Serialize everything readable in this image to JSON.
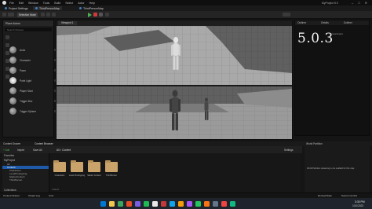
{
  "titlebar": {
    "menus": [
      "File",
      "Edit",
      "Window",
      "Tools",
      "Build",
      "Select",
      "Actor",
      "Help"
    ],
    "project_name": "MyProject 5.0",
    "controls": [
      "–",
      "□",
      "✕"
    ]
  },
  "tabs": [
    {
      "label": "Project Settings"
    },
    {
      "label": "ThirdPersonMap"
    },
    {
      "label": "ThirdPersonMap"
    }
  ],
  "toolbar": {
    "mode_label": "Selection Mode",
    "icons": [
      "save-icon",
      "content-icon",
      "blueprint-icon",
      "cinematic-icon",
      "play-icon",
      "stop-icon",
      "pause-icon"
    ]
  },
  "left_panel": {
    "title": "Place Actors",
    "search_placeholder": "Search Classes",
    "actors": [
      {
        "label": "Actor"
      },
      {
        "label": "Character"
      },
      {
        "label": "Pawn"
      },
      {
        "label": "Point Light"
      },
      {
        "label": "Player Start"
      },
      {
        "label": "Trigger Box"
      },
      {
        "label": "Trigger Sphere"
      }
    ]
  },
  "viewport": {
    "tab_label": "Viewport 1"
  },
  "outliner": {
    "tabs": [
      "Outliner",
      "Details",
      "Outliner"
    ],
    "big_version": "5.0.3",
    "version_sub": "Unreal Engine"
  },
  "content_browser": {
    "tabs": [
      "Content Drawer",
      "Content Browser"
    ],
    "toolbar": {
      "add_label": "+ Add",
      "import_label": "Import",
      "save_label": "Save All",
      "path": "All > Content",
      "settings_label": "Settings"
    },
    "sections": {
      "favorites": "Favorites",
      "project": "MyProject",
      "collections": "Collections"
    },
    "tree": [
      {
        "label": "All",
        "selected": false
      },
      {
        "label": "Content",
        "selected": true
      },
      {
        "label": "Characters",
        "selected": false
      },
      {
        "label": "LevelPrototyping",
        "selected": false
      },
      {
        "label": "StarterContent",
        "selected": false
      },
      {
        "label": "ThirdPerson",
        "selected": false
      }
    ],
    "folders": [
      {
        "label": "Characters"
      },
      {
        "label": "Level Prototyping"
      },
      {
        "label": "Starter Content"
      },
      {
        "label": "ThirdPerson"
      }
    ],
    "items_count": "4 items"
  },
  "world_partition": {
    "title": "World Partition",
    "message": "World Partition streaming is not enabled for this map."
  },
  "status": {
    "left": [
      "Content Drawer",
      "Output Log",
      "Cmd"
    ],
    "right": [
      "Derived Data",
      "Source Control"
    ]
  },
  "taskbar": {
    "time": "3:30 PM",
    "date": "10/1/2022",
    "icon_colors": [
      "#0078d4",
      "#f2c94c",
      "#3ba55d",
      "#e34c26",
      "#7b5ce5",
      "#1db954",
      "#e8e8e8",
      "#c23a3a",
      "#0ea5e9",
      "#f59e0b",
      "#a855f7",
      "#22c55e",
      "#f97316",
      "#64748b",
      "#ef4444",
      "#10b981"
    ]
  }
}
